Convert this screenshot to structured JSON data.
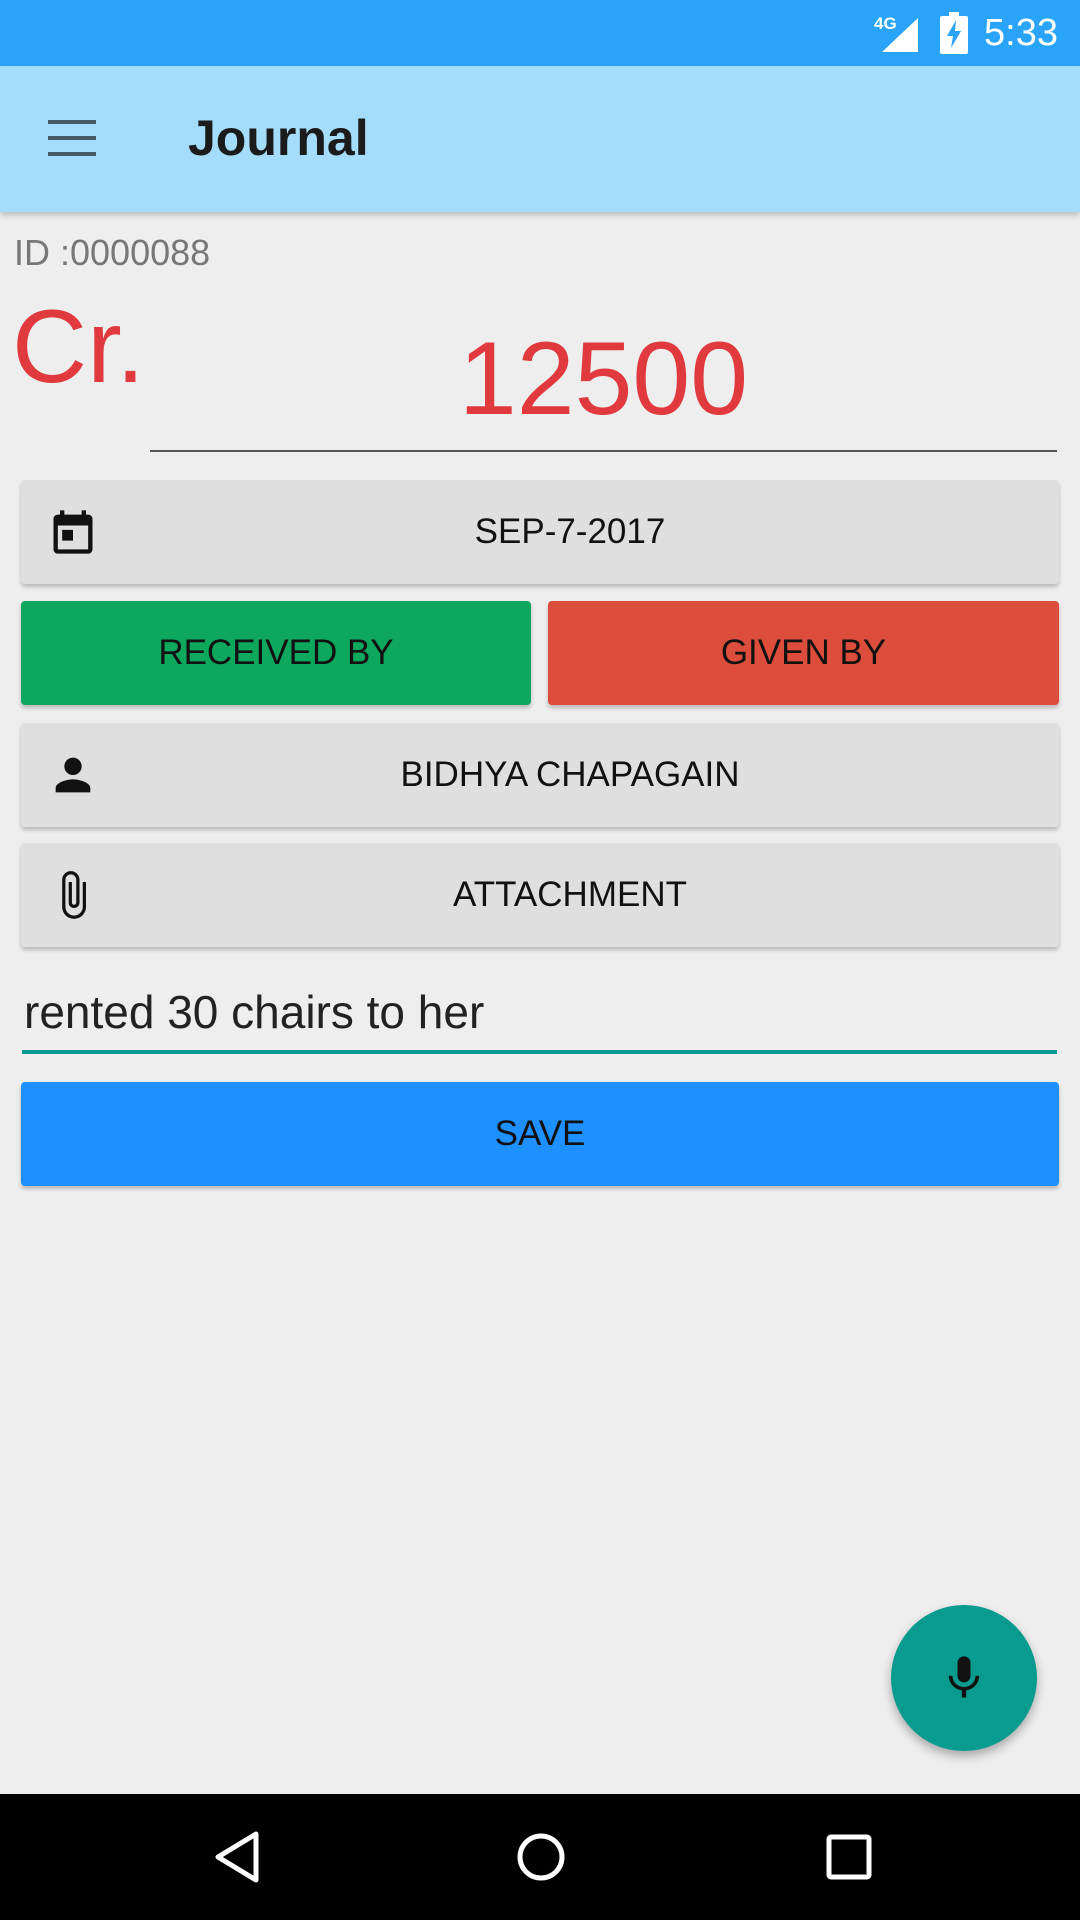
{
  "status_bar": {
    "network_label": "4G",
    "time": "5:33",
    "icons": [
      "signal-icon",
      "battery-charging-icon"
    ]
  },
  "app_bar": {
    "title": "Journal",
    "menu_icon": "menu-icon"
  },
  "entry": {
    "id_label": "ID :0000088",
    "type_label": "Cr.",
    "amount": "12500",
    "date": "SEP-7-2017",
    "received_by_label": "RECEIVED BY",
    "given_by_label": "GIVEN BY",
    "person": "BIDHYA CHAPAGAIN",
    "attachment_label": "ATTACHMENT",
    "note": "rented 30 chairs to her",
    "save_label": "SAVE"
  },
  "colors": {
    "status_bar": "#2AA4F8",
    "app_bar": "#A4DDFB",
    "credit_red": "#E03A3E",
    "received_green": "#0DA85E",
    "given_red": "#DD4D3B",
    "save_blue": "#1E90FF",
    "accent_teal": "#099B8F"
  }
}
